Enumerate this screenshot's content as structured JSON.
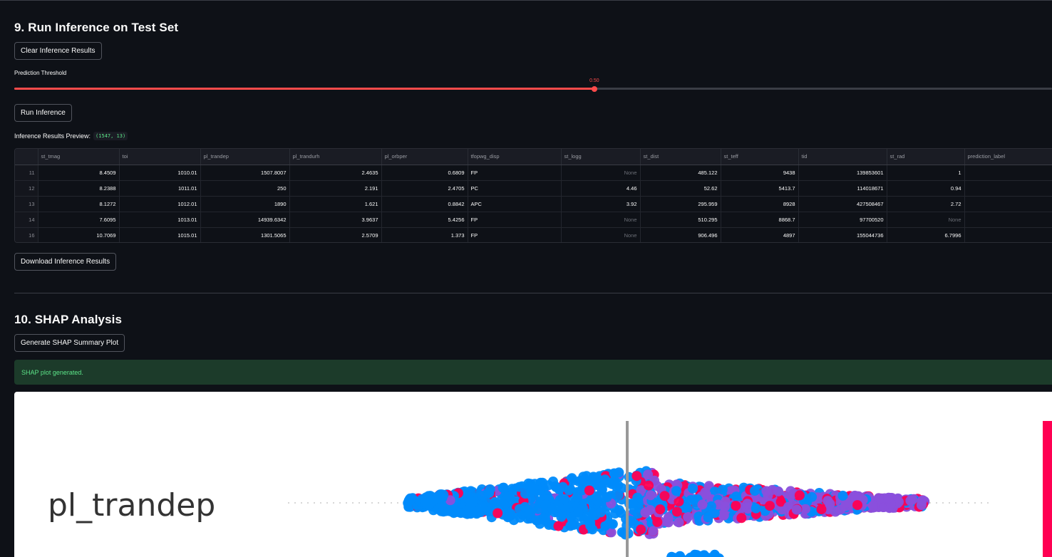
{
  "section9": {
    "title": "9. Run Inference on Test Set",
    "clear_button": "Clear Inference Results",
    "threshold_label": "Prediction Threshold",
    "threshold_value": 0.5,
    "threshold_display": "0.50",
    "run_button": "Run Inference",
    "preview_label": "Inference Results Preview:",
    "preview_shape": "(1547, 13)",
    "download_button": "Download Inference Results"
  },
  "table": {
    "columns": [
      "",
      "st_tmag",
      "toi",
      "pl_trandep",
      "pl_trandurh",
      "pl_orbper",
      "tfopwg_disp",
      "st_logg",
      "st_dist",
      "st_teff",
      "tid",
      "st_rad",
      "prediction_label"
    ],
    "rows": [
      [
        "11",
        "8.4509",
        "1010.01",
        "1507.8007",
        "2.4635",
        "0.6809",
        "FP",
        "None",
        "485.122",
        "9438",
        "139853601",
        "1",
        ""
      ],
      [
        "12",
        "8.2388",
        "1011.01",
        "250",
        "2.191",
        "2.4705",
        "PC",
        "4.46",
        "52.62",
        "5413.7",
        "114018671",
        "0.94",
        ""
      ],
      [
        "13",
        "8.1272",
        "1012.01",
        "1890",
        "1.621",
        "0.8842",
        "APC",
        "3.92",
        "295.959",
        "8928",
        "427508467",
        "2.72",
        ""
      ],
      [
        "14",
        "7.6095",
        "1013.01",
        "14939.6342",
        "3.9637",
        "5.4256",
        "FP",
        "None",
        "510.295",
        "8868.7",
        "97700520",
        "None",
        ""
      ],
      [
        "16",
        "10.7069",
        "1015.01",
        "1301.5065",
        "2.5709",
        "1.373",
        "FP",
        "None",
        "906.496",
        "4897",
        "155044736",
        "6.7996",
        ""
      ]
    ]
  },
  "section10": {
    "title": "10. SHAP Analysis",
    "generate_button": "Generate SHAP Summary Plot",
    "success_message": "SHAP plot generated."
  },
  "shap_plot": {
    "feature_label": "pl_trandep",
    "colors": {
      "low": "#008bfb",
      "high": "#ff0052",
      "mid": "#8a4fdc"
    }
  },
  "colors": {
    "background": "#0e1117",
    "accent": "#ff4b4b",
    "success_bg": "#1c3b2a",
    "success_text": "#5ce488"
  }
}
